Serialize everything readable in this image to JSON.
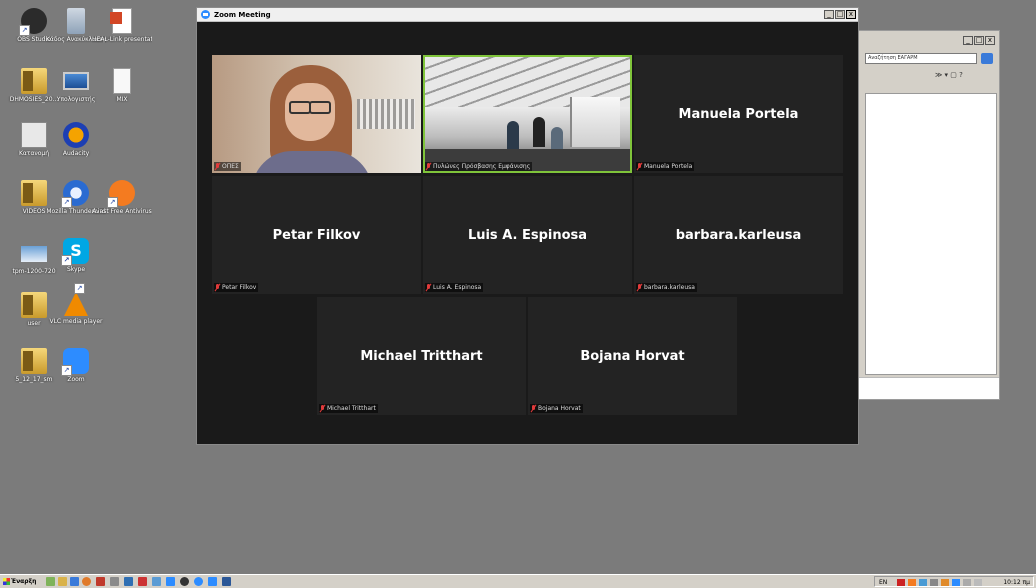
{
  "desktop": {
    "icons": [
      {
        "label": "OBS Studio",
        "icon": "obs-icon"
      },
      {
        "label": "Κάδος Ανακύκλωσης",
        "icon": "recycle-bin-icon"
      },
      {
        "label": "HEAL-Link presentation_...",
        "icon": "powerpoint-file-icon"
      },
      {
        "label": "DHMOSIES_20...",
        "icon": "folder-icon"
      },
      {
        "label": "Υπολογιστής",
        "icon": "computer-icon"
      },
      {
        "label": "MIX",
        "icon": "document-icon"
      },
      {
        "label": "Κατανομή",
        "icon": "document-icon"
      },
      {
        "label": "Audacity",
        "icon": "audacity-icon"
      },
      {
        "label": "VIDEOS",
        "icon": "folder-icon"
      },
      {
        "label": "Mozilla Thunderbird",
        "icon": "thunderbird-icon"
      },
      {
        "label": "Avast Free Antivirus",
        "icon": "avast-icon"
      },
      {
        "label": "tpm-1200-720",
        "icon": "image-file-icon"
      },
      {
        "label": "Skype",
        "icon": "skype-icon"
      },
      {
        "label": "user",
        "icon": "folder-icon"
      },
      {
        "label": "VLC media player",
        "icon": "vlc-icon"
      },
      {
        "label": "5_12_17_sm",
        "icon": "folder-icon"
      },
      {
        "label": "Zoom",
        "icon": "zoom-icon"
      }
    ]
  },
  "background_window": {
    "search_placeholder": "Αναζήτηση ΕΑΓΑΡΜ",
    "toolbar_text": "≫ ▾ ▢ ?",
    "minimize": "_",
    "maximize": "□",
    "close": "x"
  },
  "zoom": {
    "title": "Zoom Meeting",
    "minimize": "_",
    "maximize": "□",
    "close": "x",
    "participants": [
      {
        "name": "ΟΠΕΣ",
        "video": true,
        "muted": true
      },
      {
        "name": "Πυλώνες Πρόσβασης Εμφάνισης",
        "video": true,
        "muted": true,
        "active_speaker": true
      },
      {
        "name": "Manuela Portela",
        "video": false,
        "muted": true
      },
      {
        "name": "Petar Filkov",
        "video": false,
        "muted": true
      },
      {
        "name": "Luis A. Espinosa",
        "video": false,
        "muted": true
      },
      {
        "name": "barbara.karleusa",
        "video": false,
        "muted": true
      },
      {
        "name": "Michael Tritthart",
        "video": false,
        "muted": true
      },
      {
        "name": "Bojana Horvat",
        "video": false,
        "muted": true
      }
    ]
  },
  "taskbar": {
    "start_label": "Έναρξη",
    "language": "EN",
    "clock": "10:12 πμ"
  }
}
